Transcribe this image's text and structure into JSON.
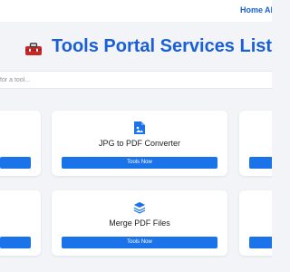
{
  "nav": {
    "home": "Home",
    "about": "Al"
  },
  "header": {
    "title": "Tools Portal Services List",
    "logo_icon": "toolbox-icon"
  },
  "search": {
    "placeholder": "for a tool..."
  },
  "cards": [
    {
      "title": "",
      "button": ""
    },
    {
      "title": "JPG to PDF Converter",
      "button": "Tools Now",
      "icon": "image-file-icon"
    },
    {
      "title": "",
      "button": ""
    },
    {
      "title": "",
      "button": ""
    },
    {
      "title": "Merge PDF Files",
      "button": "Tools Now",
      "icon": "layers-icon"
    },
    {
      "title": "",
      "button": ""
    }
  ],
  "colors": {
    "accent": "#1a73e8",
    "title": "#1a5fd6",
    "background": "#f2f4f7",
    "logo": "#c62828"
  }
}
